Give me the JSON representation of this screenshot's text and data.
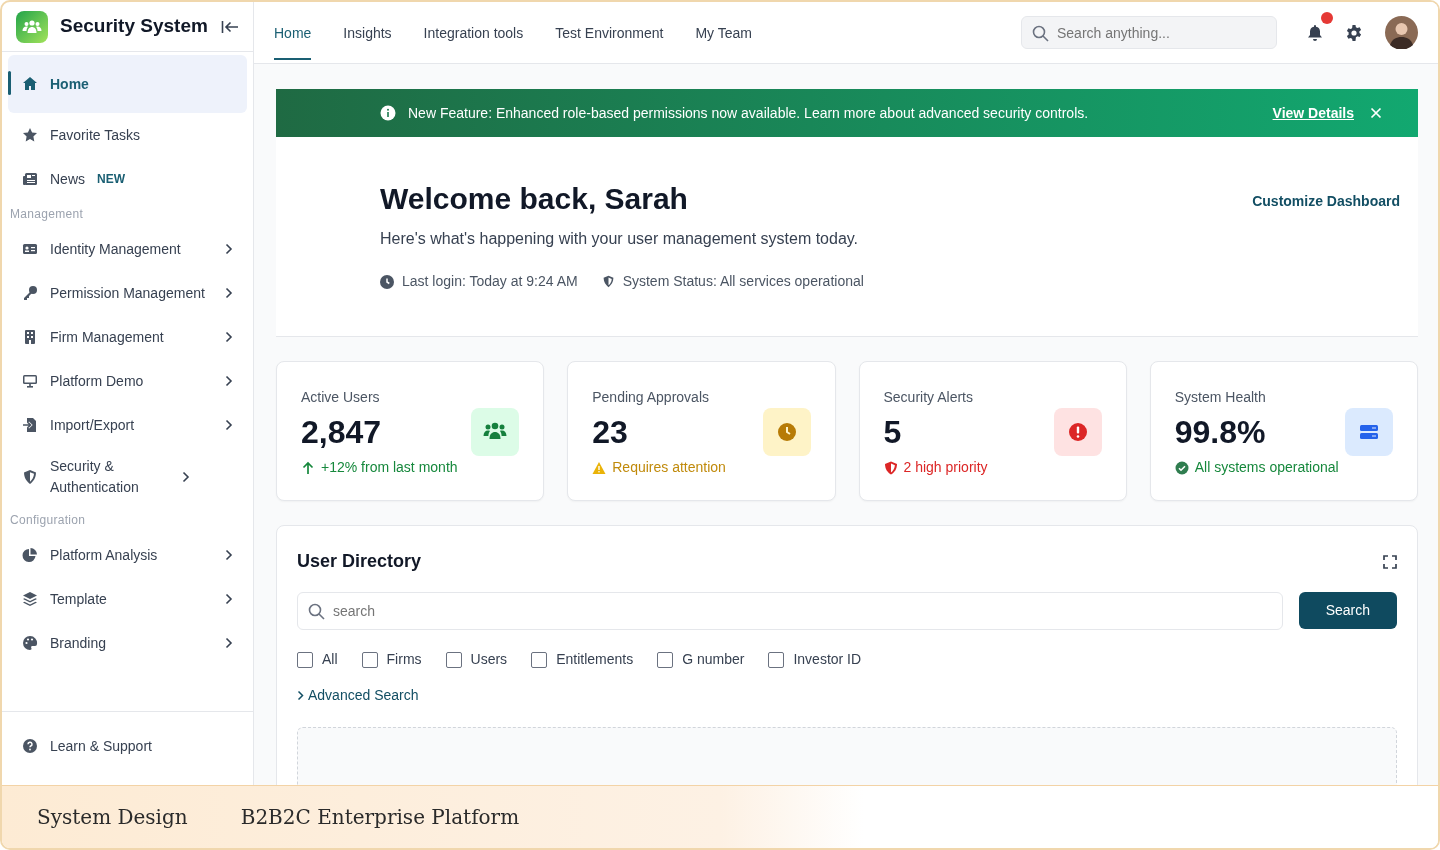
{
  "brand": {
    "title": "Security System"
  },
  "sidebar": {
    "sections": [
      {
        "items": [
          {
            "label": "Home",
            "selected": true,
            "has_submenu": false
          },
          {
            "label": "Favorite Tasks",
            "selected": false,
            "has_submenu": false
          },
          {
            "label": "News",
            "badge": "NEW",
            "selected": false,
            "has_submenu": false
          }
        ]
      },
      {
        "heading": "Management",
        "items": [
          {
            "label": "Identity Management",
            "selected": false,
            "has_submenu": true
          },
          {
            "label": "Permission Management",
            "selected": false,
            "has_submenu": true
          },
          {
            "label": "Firm Management",
            "selected": false,
            "has_submenu": true
          },
          {
            "label": "Platform Demo",
            "selected": false,
            "has_submenu": true
          },
          {
            "label": "Import/Export",
            "selected": false,
            "has_submenu": true
          },
          {
            "label": "Security & Authentication",
            "selected": false,
            "has_submenu": true
          }
        ]
      },
      {
        "heading": "Configuration",
        "items": [
          {
            "label": "Platform Analysis",
            "selected": false,
            "has_submenu": true
          },
          {
            "label": "Template",
            "selected": false,
            "has_submenu": true
          },
          {
            "label": "Branding",
            "selected": false,
            "has_submenu": true
          }
        ]
      }
    ],
    "footer": {
      "label": "Learn & Support"
    }
  },
  "tabs": [
    {
      "label": "Home",
      "selected": true
    },
    {
      "label": "Insights",
      "selected": false
    },
    {
      "label": "Integration tools",
      "selected": false
    },
    {
      "label": "Test Environment",
      "selected": false
    },
    {
      "label": "My Team",
      "selected": false
    }
  ],
  "search": {
    "placeholder": "Search anything..."
  },
  "notifications": {
    "unread": true
  },
  "banner": {
    "text": "New Feature: Enhanced role-based permissions now available. Learn more about advanced security controls.",
    "link": "View Details"
  },
  "welcome": {
    "title": "Welcome back, Sarah",
    "subtitle": "Here's what's happening with your user management system today.",
    "last_login": "Last login: Today at 9:24 AM",
    "status": "System Status: All services operational",
    "action": "Customize Dashboard"
  },
  "stats": [
    {
      "kind": "success",
      "label": "Active Users",
      "value": "2,847",
      "note": "+12% from last month"
    },
    {
      "kind": "warning",
      "label": "Pending Approvals",
      "value": "23",
      "note": "Requires attention"
    },
    {
      "kind": "danger",
      "label": "Security Alerts",
      "value": "5",
      "note": "2 high priority"
    },
    {
      "kind": "info",
      "label": "System Health",
      "value": "99.8%",
      "note": "All systems operational"
    }
  ],
  "directory": {
    "title": "User Directory",
    "search": {
      "placeholder": "search"
    },
    "button": "Search",
    "filters": [
      {
        "label": "All",
        "checked": false
      },
      {
        "label": "Firms",
        "checked": false
      },
      {
        "label": "Users",
        "checked": false
      },
      {
        "label": "Entitlements",
        "checked": false
      },
      {
        "label": "G number",
        "checked": false
      },
      {
        "label": "Investor ID",
        "checked": false
      }
    ],
    "advanced": "Advanced Search"
  },
  "caption": {
    "left": "System Design",
    "right": "B2B2C Enterprise Platform"
  }
}
